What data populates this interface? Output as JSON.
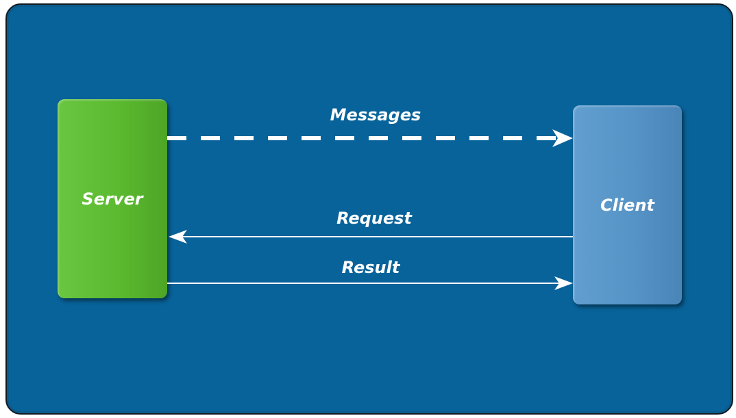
{
  "diagram": {
    "nodes": {
      "server": {
        "label": "Server",
        "color": "#5bba2f"
      },
      "client": {
        "label": "Client",
        "color": "#5693c6"
      }
    },
    "edges": {
      "messages": {
        "label": "Messages",
        "from": "Server",
        "to": "Client",
        "style": "dashed"
      },
      "request": {
        "label": "Request",
        "from": "Client",
        "to": "Server",
        "style": "solid"
      },
      "result": {
        "label": "Result",
        "from": "Server",
        "to": "Client",
        "style": "solid"
      }
    },
    "background_color": "#08639a",
    "arrow_color": "#ffffff"
  }
}
